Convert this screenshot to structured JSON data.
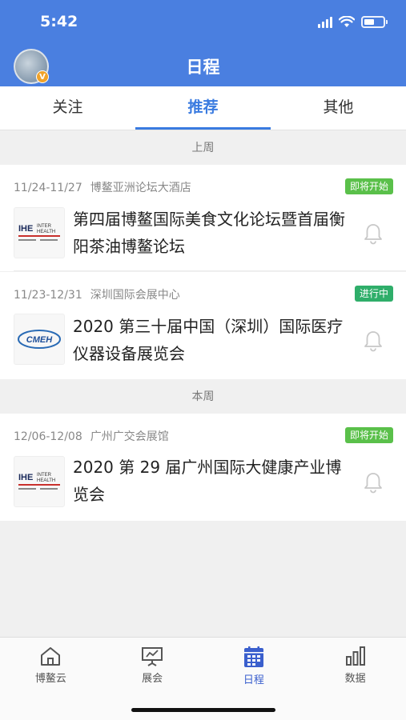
{
  "status_bar": {
    "time": "5:42"
  },
  "header": {
    "title": "日程",
    "avatar_badge": "V"
  },
  "tabs": [
    {
      "label": "关注"
    },
    {
      "label": "推荐",
      "active": true
    },
    {
      "label": "其他"
    }
  ],
  "sections": [
    {
      "label": "上周"
    },
    {
      "label": "本周"
    }
  ],
  "events": [
    {
      "dates": "11/24-11/27",
      "venue": "博鳌亚洲论坛大酒店",
      "status": "即将开始",
      "status_color": "#5ac04a",
      "title": "第四届博鳌国际美食文化论坛暨首届衡阳茶油博鳌论坛",
      "logo": "IHE INTER HEALTH"
    },
    {
      "dates": "11/23-12/31",
      "venue": "深圳国际会展中心",
      "status": "进行中",
      "status_color": "#2fae6a",
      "title": "2020 第三十届中国（深圳）国际医疗仪器设备展览会",
      "logo": "CMEH"
    },
    {
      "dates": "12/06-12/08",
      "venue": "广州广交会展馆",
      "status": "即将开始",
      "status_color": "#5ac04a",
      "title": "2020 第 29 届广州国际大健康产业博览会",
      "logo": "IHE INTER HEALTH"
    }
  ],
  "tabbar": [
    {
      "label": "博鳌云",
      "icon": "home-icon"
    },
    {
      "label": "展会",
      "icon": "presentation-icon"
    },
    {
      "label": "日程",
      "icon": "calendar-icon",
      "active": true
    },
    {
      "label": "数据",
      "icon": "bar-chart-icon"
    }
  ],
  "colors": {
    "primary": "#4a7fe0",
    "tab_active": "#3a7be0"
  }
}
